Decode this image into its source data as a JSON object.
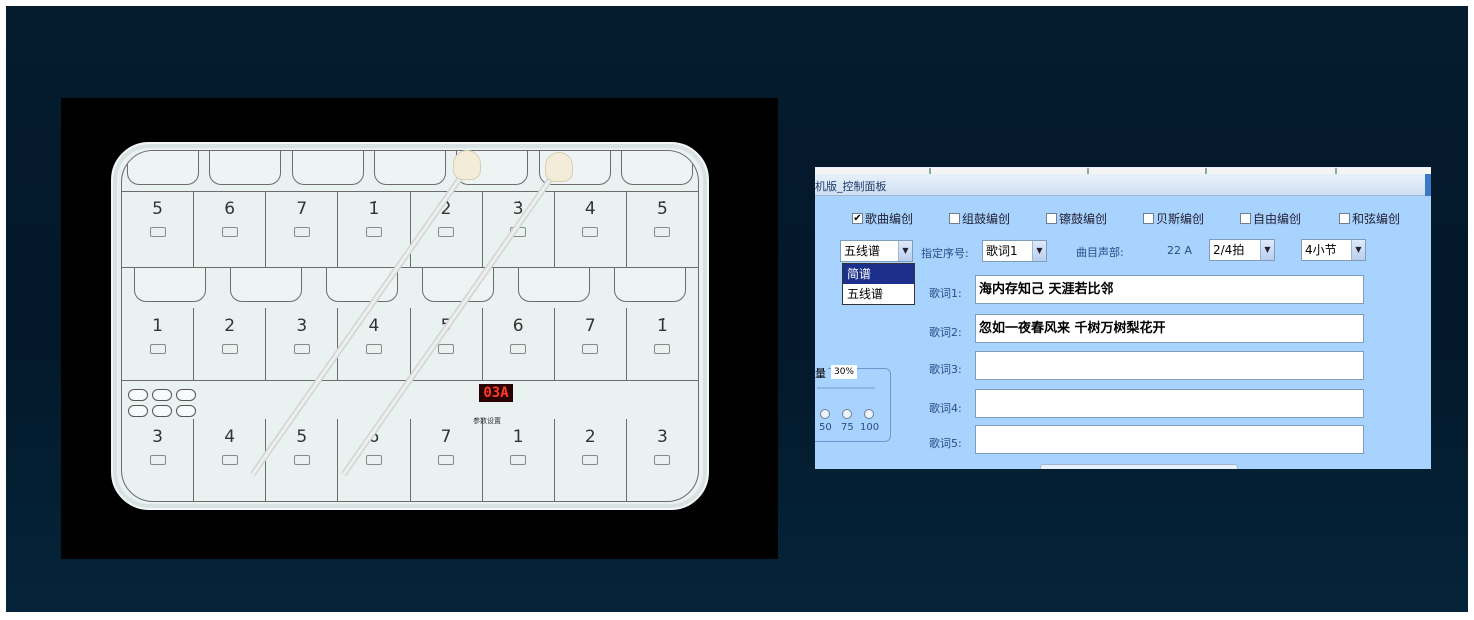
{
  "photo": {
    "top_keys": [
      "5",
      "6",
      "7",
      "1̇",
      "2̇",
      "3̇",
      "4̇",
      "5̇"
    ],
    "mid_keys": [
      "1",
      "2",
      "3",
      "4",
      "5",
      "6",
      "7",
      "1̇"
    ],
    "bot_keys": [
      "3",
      "4",
      "5",
      "6",
      "7",
      "1",
      "2",
      "3"
    ],
    "led_display": "03A",
    "led_caption": "参数设置"
  },
  "panel": {
    "title": "机版_控制面板",
    "checkboxes": [
      {
        "label": "歌曲编创",
        "checked": true
      },
      {
        "label": "组鼓编创",
        "checked": false
      },
      {
        "label": "镲鼓编创",
        "checked": false
      },
      {
        "label": "贝斯编创",
        "checked": false
      },
      {
        "label": "自由编创",
        "checked": false
      },
      {
        "label": "和弦编创",
        "checked": false
      }
    ],
    "score_type_value": "五线谱",
    "score_type_options": [
      "简谱",
      "五线谱"
    ],
    "score_type_selected": "简谱",
    "seq_label": "指定序号:",
    "seq_value": "歌词1",
    "voice_label": "曲目声部:",
    "voice_value": "22 A",
    "beat_value": "2/4拍",
    "bars_value": "4小节",
    "lyrics": [
      {
        "label": "歌词1:",
        "value": "海内存知己 天涯若比邻"
      },
      {
        "label": "歌词2:",
        "value": "忽如一夜春风来 千树万树梨花开"
      },
      {
        "label": "歌词3:",
        "value": ""
      },
      {
        "label": "歌词4:",
        "value": ""
      },
      {
        "label": "歌词5:",
        "value": ""
      }
    ],
    "volume_label": "量",
    "volume_value": "30%",
    "volume_options": [
      "50",
      "75",
      "100"
    ]
  }
}
